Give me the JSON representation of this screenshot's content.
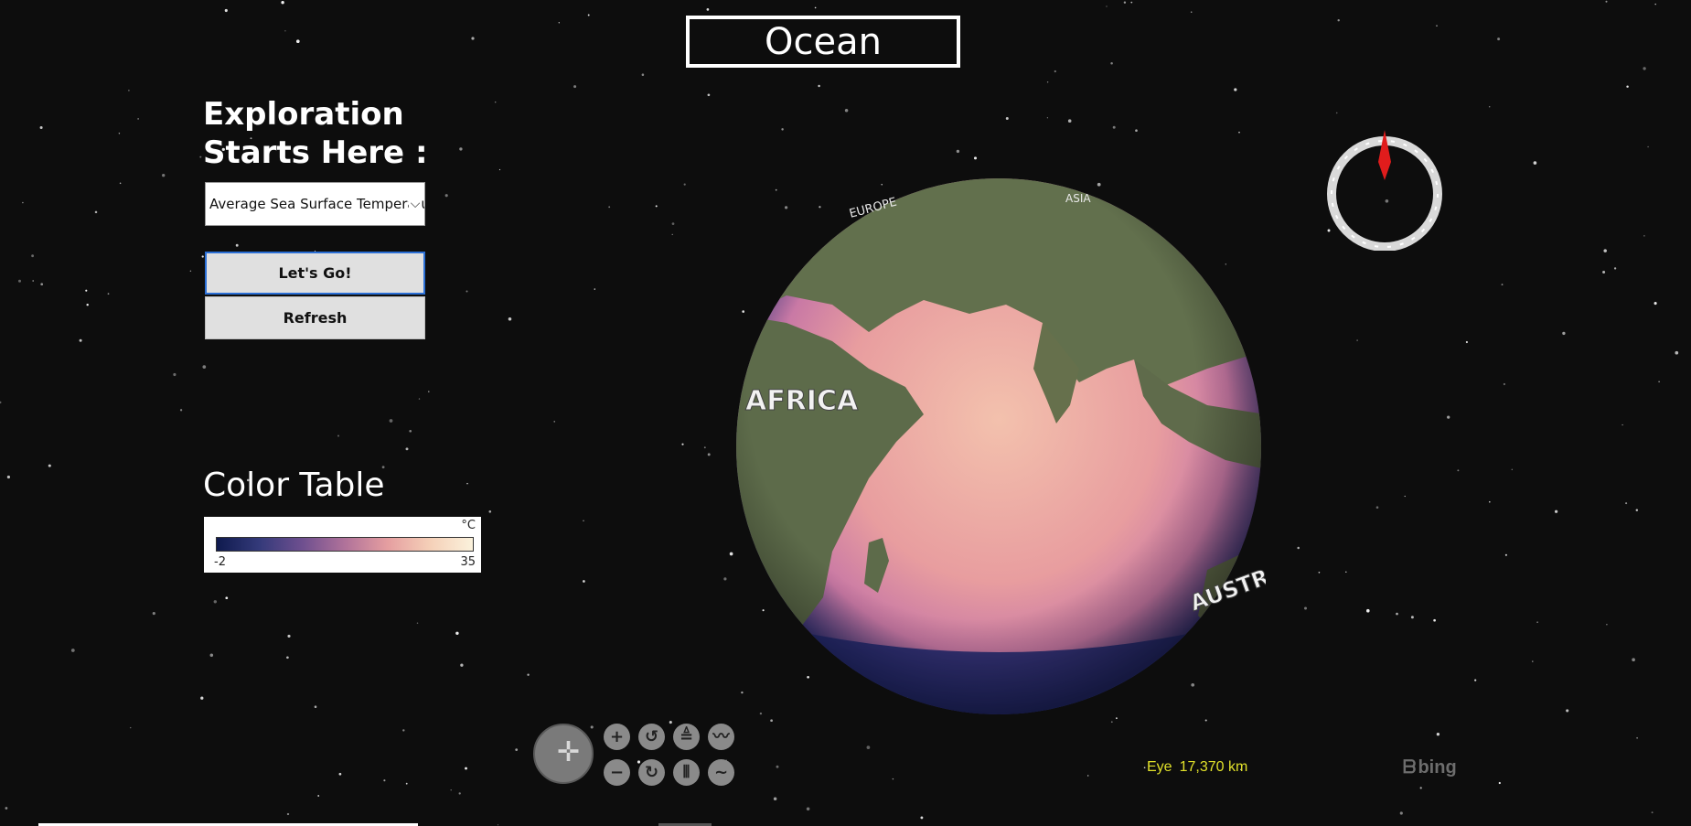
{
  "app": {
    "title": "Ocean"
  },
  "sidebar": {
    "heading": "Exploration Starts Here :",
    "dataset_select": {
      "selected": "Average Sea Surface Temperature"
    },
    "go_button": "Let's Go!",
    "refresh_button": "Refresh",
    "color_table_heading": "Color Table"
  },
  "legend": {
    "unit": "°C",
    "min": "-2",
    "max": "35",
    "colors": [
      "#0f1a4e",
      "#343a7a",
      "#6e4f8f",
      "#b0729a",
      "#e59ea0",
      "#f5d0b8",
      "#fbf2dc"
    ]
  },
  "globe": {
    "labels": [
      "AFRICA",
      "AUSTRALIA",
      "EUROPE",
      "ASIA"
    ],
    "ocean_color": "#e8a0a0",
    "land_color": "#5d6d4a"
  },
  "controls": {
    "icons": [
      "pan-icon",
      "zoom-in-icon",
      "rotate-left-icon",
      "tilt-up-icon",
      "exaggeration-up-icon",
      "zoom-out-icon",
      "rotate-right-icon",
      "tilt-down-icon",
      "exaggeration-down-icon"
    ]
  },
  "status": {
    "eye_label": "Eye",
    "eye_value": "17,370 km",
    "bing": "bing"
  }
}
